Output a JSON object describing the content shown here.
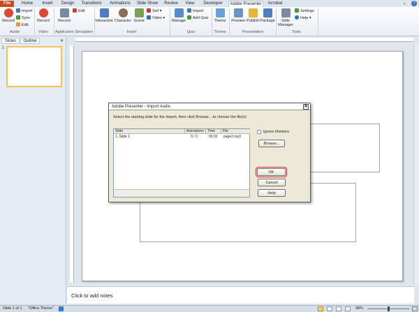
{
  "tabs": [
    "File",
    "Home",
    "Insert",
    "Design",
    "Transitions",
    "Animations",
    "Slide Show",
    "Review",
    "View",
    "Developer",
    "Adobe Presenter",
    "Acrobat"
  ],
  "ribbon": {
    "audio": {
      "record": "Record",
      "import": "Import",
      "sync": "Sync",
      "edit": "Edit",
      "label": "Audio"
    },
    "video": {
      "record": "Record",
      "label": "Video"
    },
    "appsim": {
      "record": "Record",
      "edit": "Edit",
      "label": "Application Simulation"
    },
    "insert": {
      "interaction": "Interaction",
      "character": "Character",
      "scene": "Scene",
      "swf": "Swf",
      "video": "Video",
      "label": "Insert"
    },
    "quiz": {
      "manage": "Manage",
      "import": "Import",
      "add_quiz": "Add Quiz",
      "label": "Quiz"
    },
    "theme": {
      "theme": "Theme",
      "label": "Theme"
    },
    "presentation": {
      "preview": "Preview",
      "publish": "Publish",
      "package": "Package",
      "label": "Presentation"
    },
    "tools": {
      "slide_manager": "Slide Manager",
      "settings": "Settings",
      "help": "Help",
      "label": "Tools"
    }
  },
  "left_pane": {
    "tab_slides": "Slides",
    "tab_outline": "Outline",
    "close": "✕",
    "slide_number": "1"
  },
  "dialog": {
    "title": "Adobe Presenter - Import Audio",
    "close": "✕",
    "instruction": "Select the starting slide for the import, then click Browse... to choose the file(s)",
    "columns": [
      "Slide",
      "Animations",
      "Time",
      "File"
    ],
    "rows": [
      {
        "slide": "1. Slide 1",
        "animations": "0 / 0",
        "time": "00:33",
        "file": "page2.mp3"
      }
    ],
    "ignore_markers": "Ignore Markers",
    "browse": "Browse...",
    "ok": "OK",
    "cancel": "Cancel",
    "help": "Help"
  },
  "notes_placeholder": "Click to add notes",
  "status": {
    "slide": "Slide 1 of 1",
    "theme": "\"Office Theme\"",
    "zoom": "98%"
  },
  "colors": {
    "file_tab": "#c94a1c",
    "highlight": "#d9262c"
  }
}
